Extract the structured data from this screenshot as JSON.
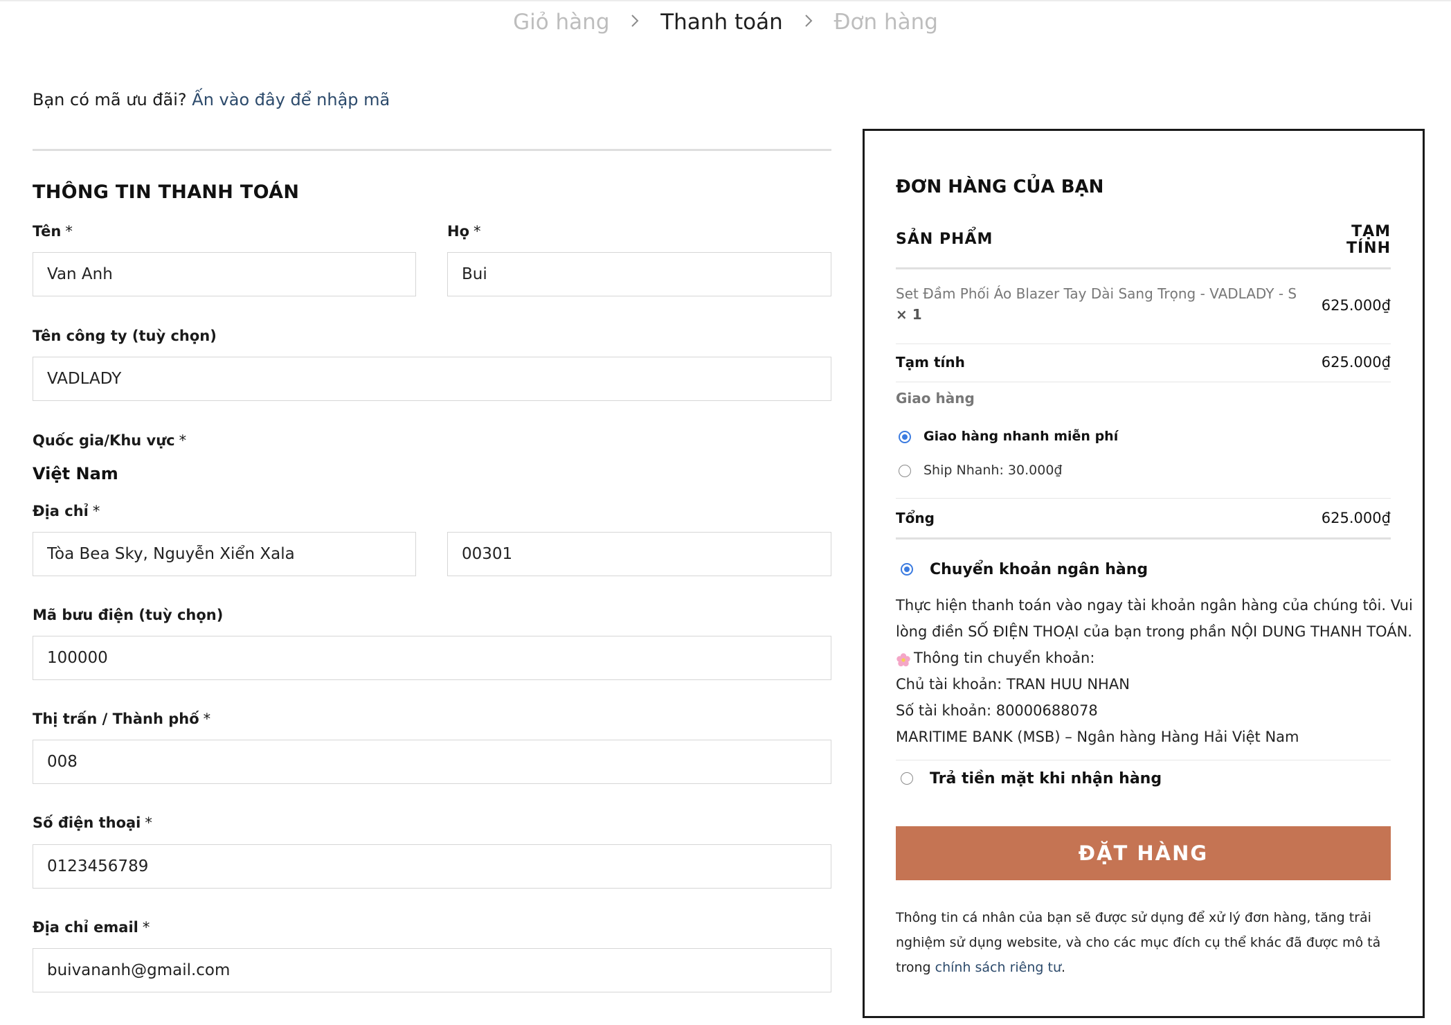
{
  "breadcrumb": {
    "cart": "Giỏ hàng",
    "checkout": "Thanh toán",
    "order": "Đơn hàng"
  },
  "coupon": {
    "prompt": "Bạn có mã ưu đãi?",
    "link": "Ấn vào đây để nhập mã"
  },
  "billing": {
    "title": "THÔNG TIN THANH TOÁN",
    "required_mark": "*",
    "first_name": {
      "label": "Tên",
      "value": "Van Anh"
    },
    "last_name": {
      "label": "Họ",
      "value": "Bui"
    },
    "company": {
      "label": "Tên công ty (tuỳ chọn)",
      "value": "VADLADY"
    },
    "country": {
      "label": "Quốc gia/Khu vực",
      "value": "Việt Nam"
    },
    "address": {
      "label": "Địa chỉ",
      "street": "Tòa Bea Sky, Nguyễn Xiển Xala",
      "line2": "00301"
    },
    "postcode": {
      "label": "Mã bưu điện (tuỳ chọn)",
      "value": "100000"
    },
    "city": {
      "label": "Thị trấn / Thành phố",
      "value": "008"
    },
    "phone": {
      "label": "Số điện thoại",
      "value": "0123456789"
    },
    "email": {
      "label": "Địa chỉ email",
      "value": "buivananh@gmail.com"
    }
  },
  "order": {
    "title": "ĐƠN HÀNG CỦA BẠN",
    "col_product": "SẢN PHẨM",
    "col_subtotal_line1": "TẠM",
    "col_subtotal_line2": "TÍNH",
    "product": {
      "name": "Set Đầm Phối Áo Blazer Tay Dài Sang Trọng - VADLADY - S",
      "qty": "× 1",
      "price": "625.000₫"
    },
    "subtotal_label": "Tạm tính",
    "subtotal_value": "625.000₫",
    "shipping_label": "Giao hàng",
    "shipping_options": [
      {
        "label": "Giao hàng nhanh miễn phí",
        "selected": true
      },
      {
        "label": "Ship Nhanh:",
        "price": "30.000₫",
        "selected": false
      }
    ],
    "total_label": "Tổng",
    "total_value": "625.000₫"
  },
  "payment": {
    "bank": {
      "label": "Chuyển khoản ngân hàng",
      "selected": true,
      "desc_line1": "Thực hiện thanh toán vào ngay tài khoản ngân hàng của chúng tôi. Vui",
      "desc_line2": "lòng điền SỐ ĐIỆN THOẠI của bạn trong phần NỘI DUNG THANH TOÁN.",
      "desc_line3": "Thông tin chuyển khoản:",
      "desc_line4": "Chủ tài khoản: TRAN HUU NHAN",
      "desc_line5": "Số tài khoản: 80000688078",
      "desc_line6": "MARITIME BANK (MSB) – Ngân hàng Hàng Hải Việt Nam"
    },
    "cod": {
      "label": "Trả tiền mặt khi nhận hàng",
      "selected": false
    }
  },
  "place_order_label": "ĐẶT HÀNG",
  "privacy": {
    "text1": "Thông tin cá nhân của bạn sẽ được sử dụng để xử lý đơn hàng, tăng trải",
    "text2": "nghiệm sử dụng website, và cho các mục đích cụ thể khác đã được mô tả",
    "text3_prefix": "trong",
    "link": "chính sách riêng tư",
    "text3_suffix": "."
  },
  "colors": {
    "accent_button": "#c57453",
    "link": "#2c4a6b",
    "radio_active": "#3b7be0"
  }
}
